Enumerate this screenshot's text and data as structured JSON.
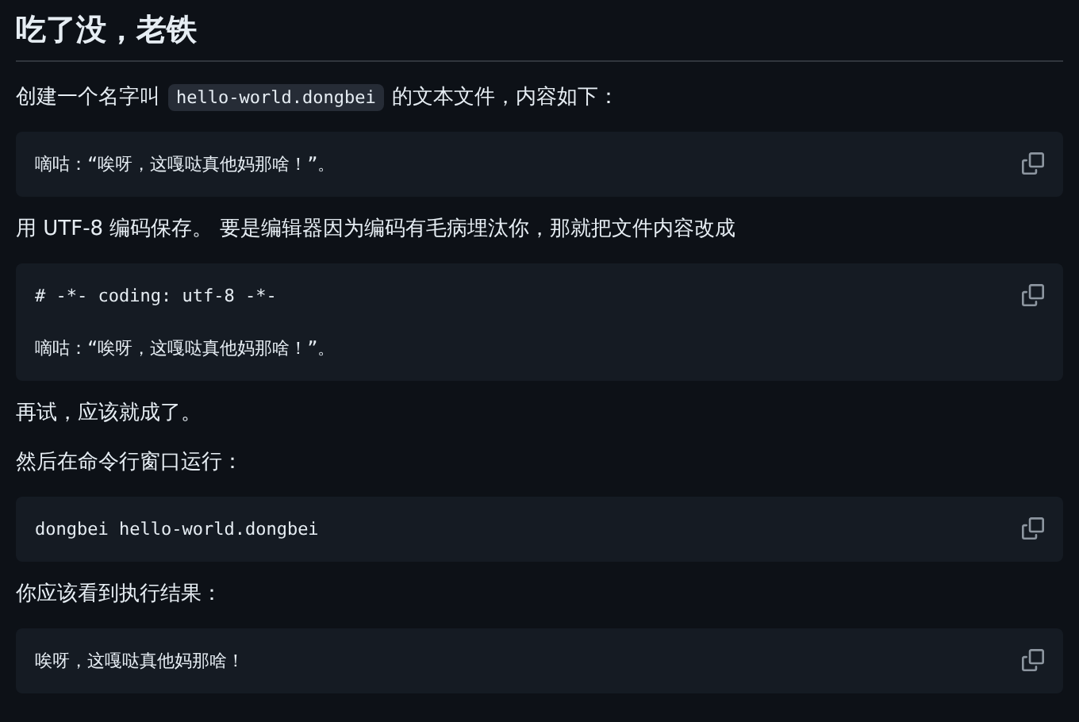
{
  "heading": "吃了没，老铁",
  "blocks": [
    {
      "kind": "paragraph",
      "parts": [
        {
          "text": "创建一个名字叫",
          "code": false
        },
        {
          "text": "hello-world.dongbei",
          "code": true
        },
        {
          "text": "的文本文件，内容如下：",
          "code": false
        }
      ]
    },
    {
      "kind": "code",
      "lines": [
        "嘀咕：“唉呀，这嘎哒真他妈那啥！”。"
      ]
    },
    {
      "kind": "paragraph",
      "parts": [
        {
          "text": "用 UTF-8 编码保存。 要是编辑器因为编码有毛病埋汰你，那就把文件内容改成",
          "code": false
        }
      ]
    },
    {
      "kind": "code",
      "lines": [
        "# -*- coding: utf-8 -*-",
        "嘀咕：“唉呀，这嘎哒真他妈那啥！”。"
      ]
    },
    {
      "kind": "paragraph",
      "parts": [
        {
          "text": "再试，应该就成了。",
          "code": false
        }
      ]
    },
    {
      "kind": "paragraph",
      "parts": [
        {
          "text": "然后在命令行窗口运行：",
          "code": false
        }
      ]
    },
    {
      "kind": "code",
      "lines": [
        "dongbei hello-world.dongbei"
      ]
    },
    {
      "kind": "paragraph",
      "parts": [
        {
          "text": "你应该看到执行结果：",
          "code": false
        }
      ]
    },
    {
      "kind": "code",
      "lines": [
        "唉呀，这嘎哒真他妈那啥！"
      ]
    }
  ]
}
